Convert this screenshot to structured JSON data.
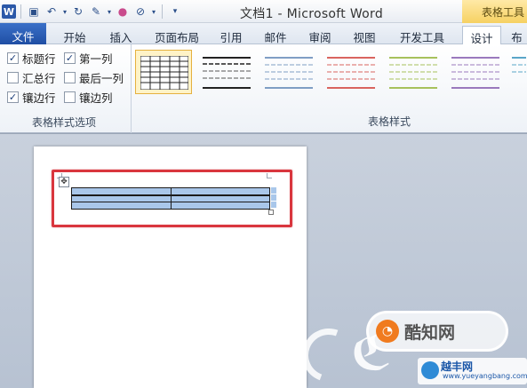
{
  "window": {
    "title": "文档1 - Microsoft Word",
    "context_tab_group": "表格工具"
  },
  "quick_access": {
    "icons": [
      "word-app-icon",
      "save-icon",
      "undo-icon",
      "redo-icon",
      "format-painter-icon",
      "color-icon",
      "draw-icon",
      "customize-qat-icon"
    ]
  },
  "tabs": [
    {
      "label": "文件",
      "active": false,
      "type": "file"
    },
    {
      "label": "开始",
      "active": false
    },
    {
      "label": "插入",
      "active": false
    },
    {
      "label": "页面布局",
      "active": false
    },
    {
      "label": "引用",
      "active": false
    },
    {
      "label": "邮件",
      "active": false
    },
    {
      "label": "审阅",
      "active": false
    },
    {
      "label": "视图",
      "active": false
    },
    {
      "label": "开发工具",
      "active": false
    },
    {
      "label": "设计",
      "active": true
    },
    {
      "label": "布",
      "active": false
    }
  ],
  "style_options": {
    "group_label": "表格样式选项",
    "options": [
      {
        "label": "标题行",
        "checked": true
      },
      {
        "label": "第一列",
        "checked": true
      },
      {
        "label": "汇总行",
        "checked": false
      },
      {
        "label": "最后一列",
        "checked": false
      },
      {
        "label": "镶边行",
        "checked": true
      },
      {
        "label": "镶边列",
        "checked": false
      }
    ]
  },
  "table_styles": {
    "group_label": "表格样式",
    "colors": [
      "#222222",
      "#222222",
      "#7f9ec4",
      "#d9645f",
      "#a7c15c",
      "#9a79bd",
      "#5aa6c8"
    ],
    "selected_index": 0
  },
  "document": {
    "table": {
      "rows": 3,
      "cols": 2,
      "fill": "#a9c7ea"
    },
    "highlight_color": "#d9363e"
  },
  "watermark": {
    "badge_text": "酷知网",
    "site_name": "越丰网",
    "site_url": "www.yueyangbang.com"
  }
}
